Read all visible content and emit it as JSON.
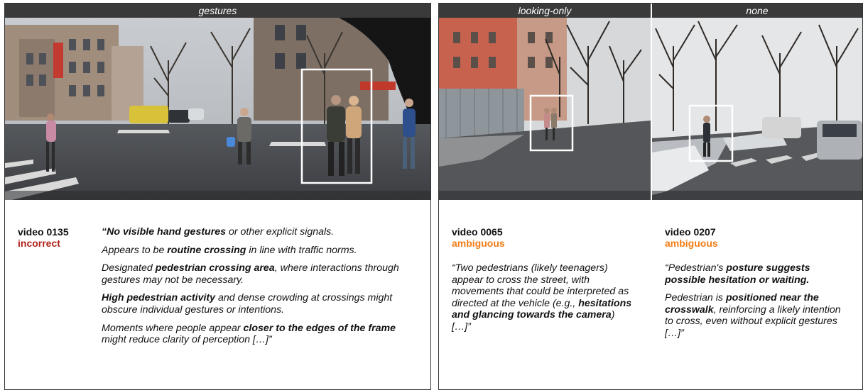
{
  "panels": {
    "left": {
      "header": "gestures",
      "video_label": "video 0135",
      "status": "incorrect",
      "quote": [
        [
          {
            "b": "“"
          },
          {
            "bi": "No visible hand gestures"
          },
          {
            "t": " or other explicit signals."
          }
        ],
        [
          {
            "t": "Appears to be "
          },
          {
            "bi": "routine crossing"
          },
          {
            "t": " in line with traffic norms."
          }
        ],
        [
          {
            "t": "Designated "
          },
          {
            "bi": "pedestrian crossing area"
          },
          {
            "t": ", where interactions through gestures may not be necessary."
          }
        ],
        [
          {
            "bi": "High pedestrian activity"
          },
          {
            "t": " and dense crowding at crossings might obscure individual gestures or intentions."
          }
        ],
        [
          {
            "t": "Moments where people appear "
          },
          {
            "bi": "closer to the edges of the frame"
          },
          {
            "t": " might reduce clarity of perception […]”"
          }
        ]
      ]
    },
    "middle": {
      "header": "looking-only",
      "video_label": "video 0065",
      "status": "ambiguous",
      "quote": [
        [
          {
            "t": "“Two pedestrians (likely teenagers) appear to cross the street, with movements that could be interpreted as directed at the vehicle (e.g., "
          },
          {
            "bi": "hesitations and glancing towards the camera"
          },
          {
            "t": ") […]”"
          }
        ]
      ]
    },
    "right": {
      "header": "none",
      "video_label": "video 0207",
      "status": "ambiguous",
      "quote": [
        [
          {
            "t": "“Pedestrian's "
          },
          {
            "bi": "posture suggests possible hesitation or waiting."
          }
        ],
        [
          {
            "t": "Pedestrian is "
          },
          {
            "bi": "positioned near the crosswalk"
          },
          {
            "t": ", reinforcing a likely intention to cross, even without explicit gestures […]”"
          }
        ]
      ]
    }
  },
  "colors": {
    "header_bg": "#3a3a3a",
    "incorrect": "#b0211b",
    "ambiguous": "#f07d18",
    "bbox": "#ffffff"
  }
}
